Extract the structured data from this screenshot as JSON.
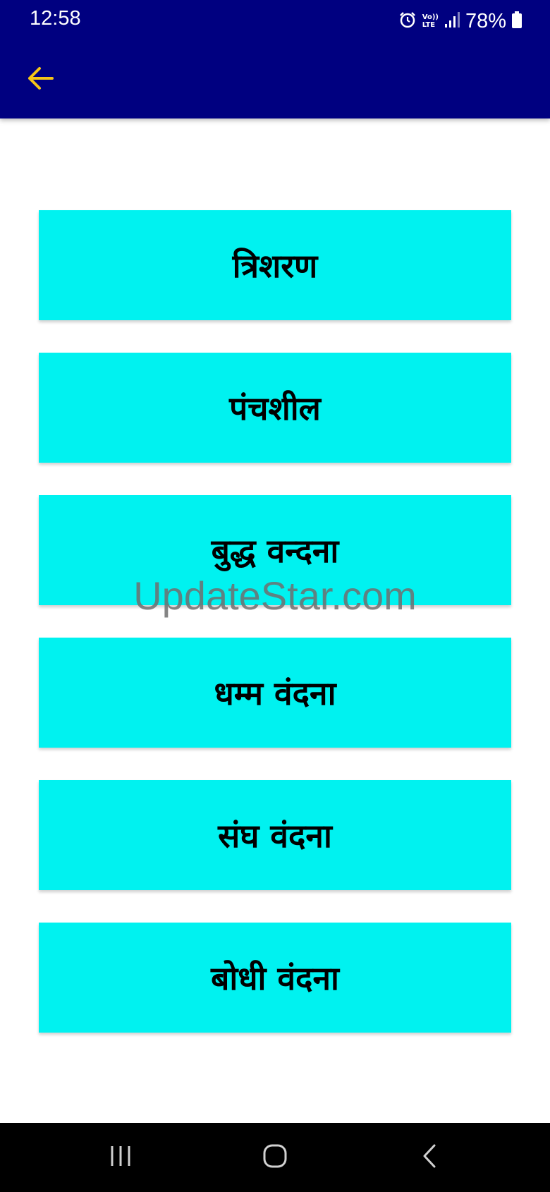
{
  "status_bar": {
    "time": "12:58",
    "battery": "78%",
    "lte_top": "Vo))",
    "lte_bottom": "LTE",
    "icons": [
      "alarm-icon",
      "volte-icon",
      "signal-icon",
      "battery-icon"
    ]
  },
  "app_bar": {
    "background": "#000080",
    "back_icon": "arrow-left-icon",
    "back_color": "#f5c518"
  },
  "menu": {
    "accent": "#00f2f0",
    "items": [
      {
        "label": "त्रिशरण"
      },
      {
        "label": "पंचशील"
      },
      {
        "label": "बुद्ध वन्दना"
      },
      {
        "label": "धम्म वंदना"
      },
      {
        "label": "संघ वंदना"
      },
      {
        "label": "बोधी वंदना"
      }
    ]
  },
  "watermark": "UpdateStar.com",
  "nav_bar": {
    "icons": [
      "recent-apps-icon",
      "home-icon",
      "back-icon"
    ]
  }
}
